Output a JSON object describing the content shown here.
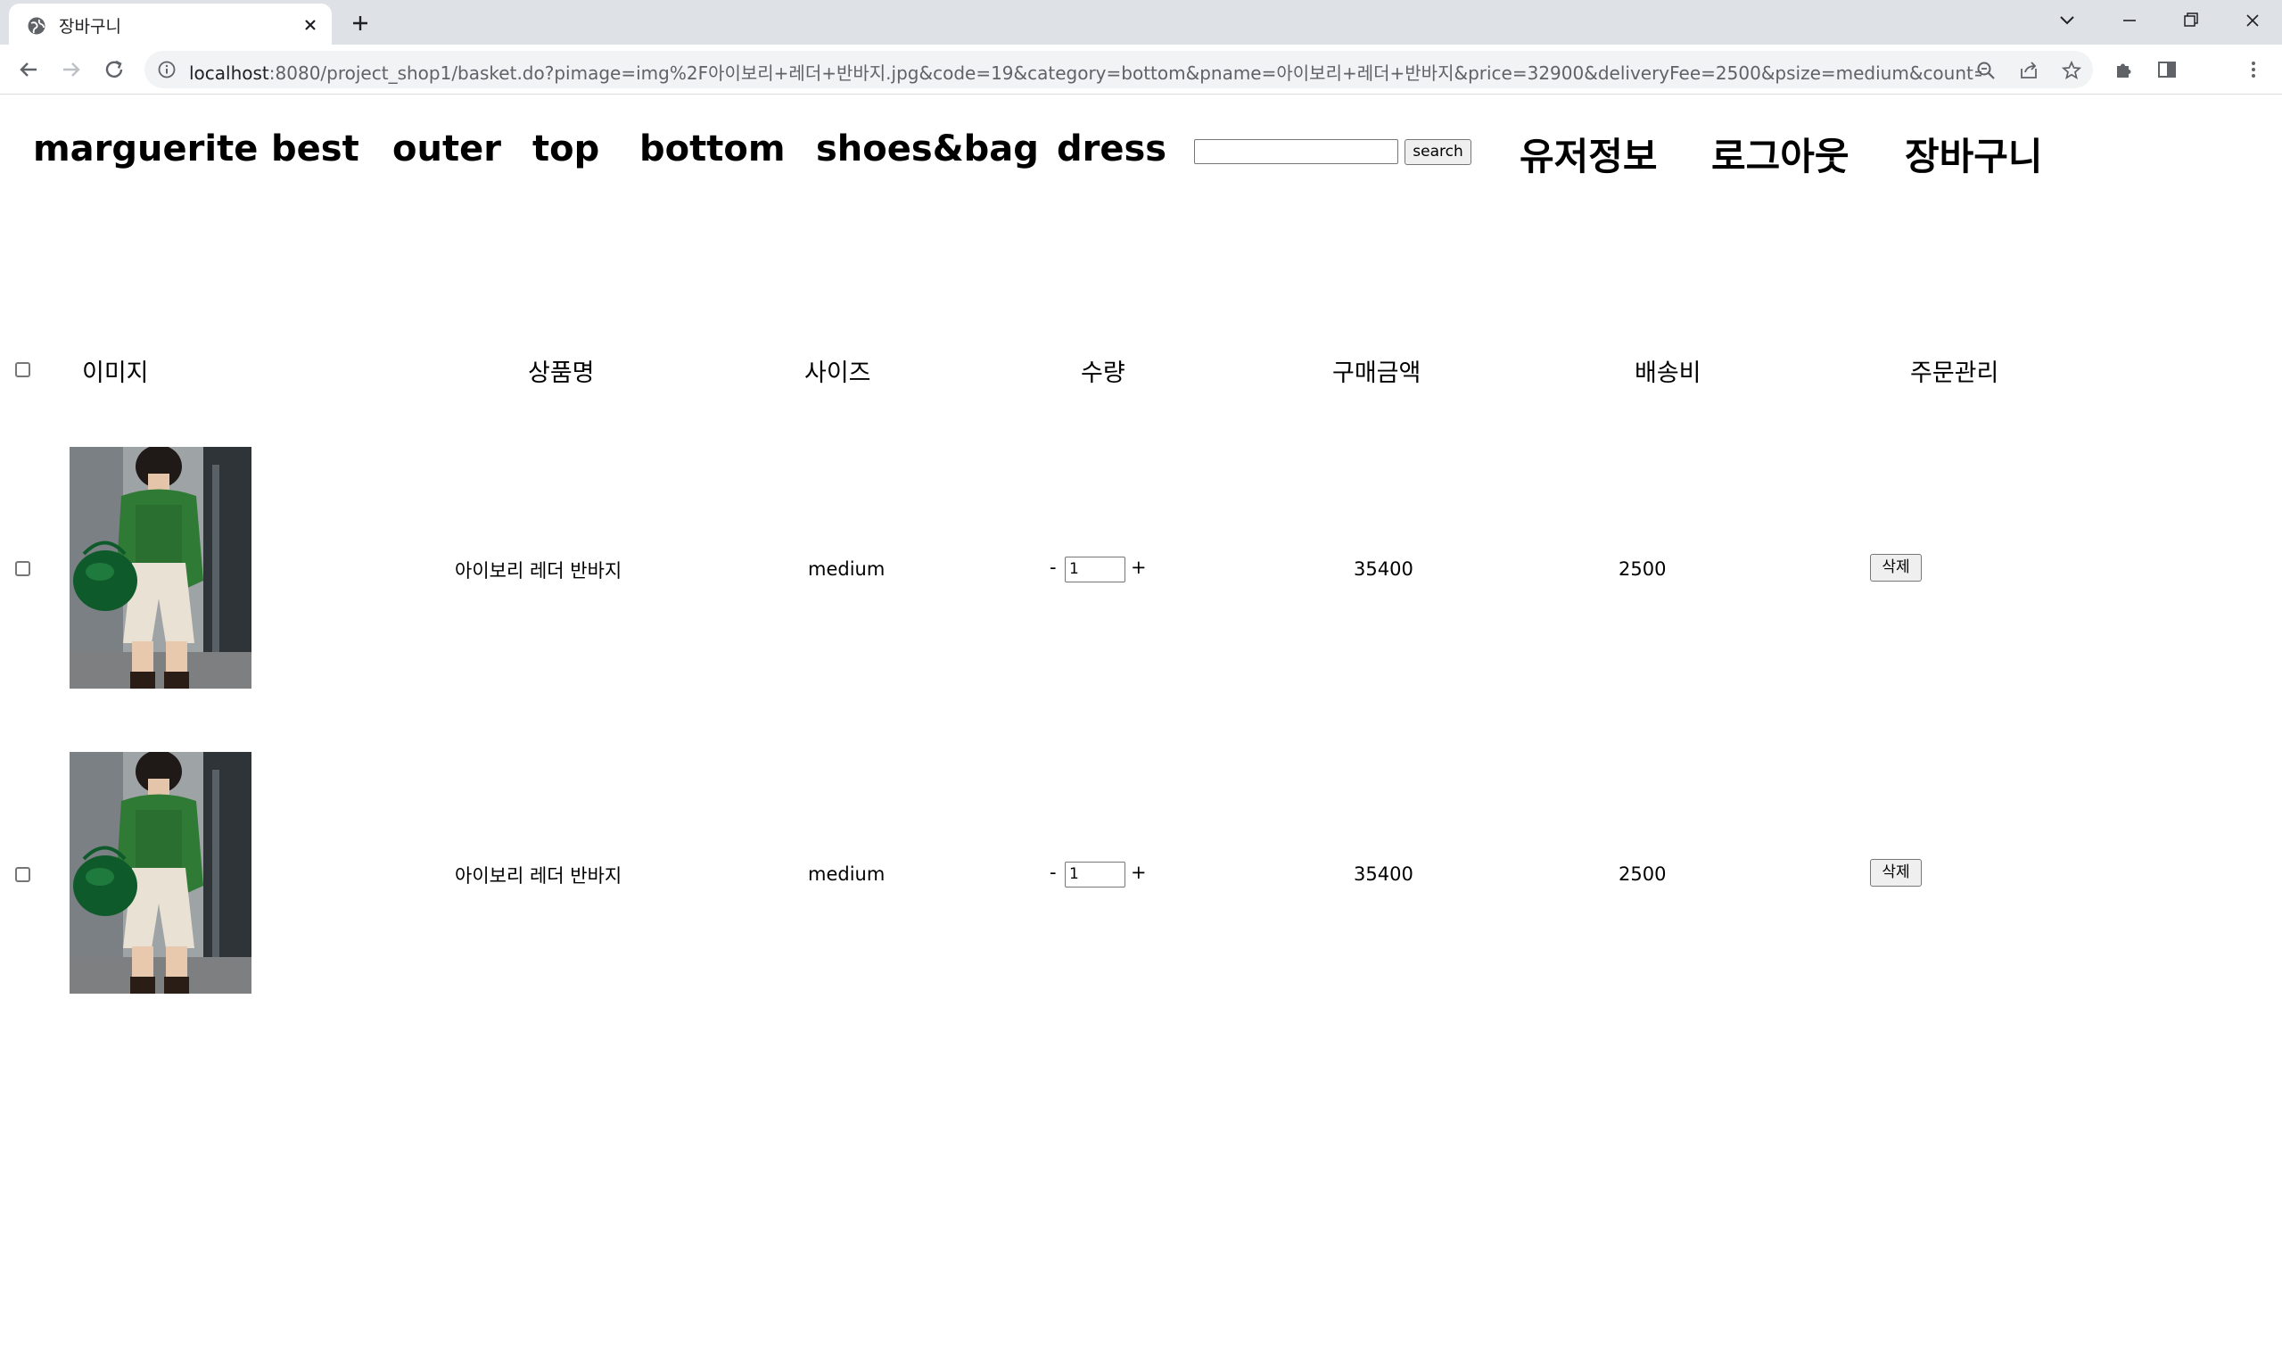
{
  "browser": {
    "tab_title": "장바구니",
    "url_host": "localhost",
    "url_rest": ":8080/project_shop1/basket.do?pimage=img%2F아이보리+레더+반바지.jpg&code=19&category=bottom&pname=아이보리+레더+반바지&price=32900&deliveryFee=2500&psize=medium&count=..."
  },
  "nav": {
    "brand": "marguerite",
    "items": [
      "best",
      "outer",
      "top",
      "bottom",
      "shoes&bag",
      "dress"
    ],
    "search_button": "search",
    "search_value": "",
    "user_links": [
      "유저정보",
      "로그아웃",
      "장바구니"
    ]
  },
  "table": {
    "headers": [
      "이미지",
      "상품명",
      "사이즈",
      "수량",
      "구매금액",
      "배송비",
      "주문관리"
    ],
    "rows": [
      {
        "name": "아이보리 레더 반바지",
        "size": "medium",
        "qty": "1",
        "price": "35400",
        "delivery": "2500",
        "delete_label": "삭제"
      },
      {
        "name": "아이보리 레더 반바지",
        "size": "medium",
        "qty": "1",
        "price": "35400",
        "delivery": "2500",
        "delete_label": "삭제"
      }
    ],
    "qty_minus": "-",
    "qty_plus": "+"
  },
  "colors": {
    "tabstrip": "#dee1e6",
    "omnibox": "#f1f3f4",
    "cardigan_green": "#2f7a35",
    "bag_green": "#0f5a2a",
    "shorts_ivory": "#e9e1d3"
  }
}
